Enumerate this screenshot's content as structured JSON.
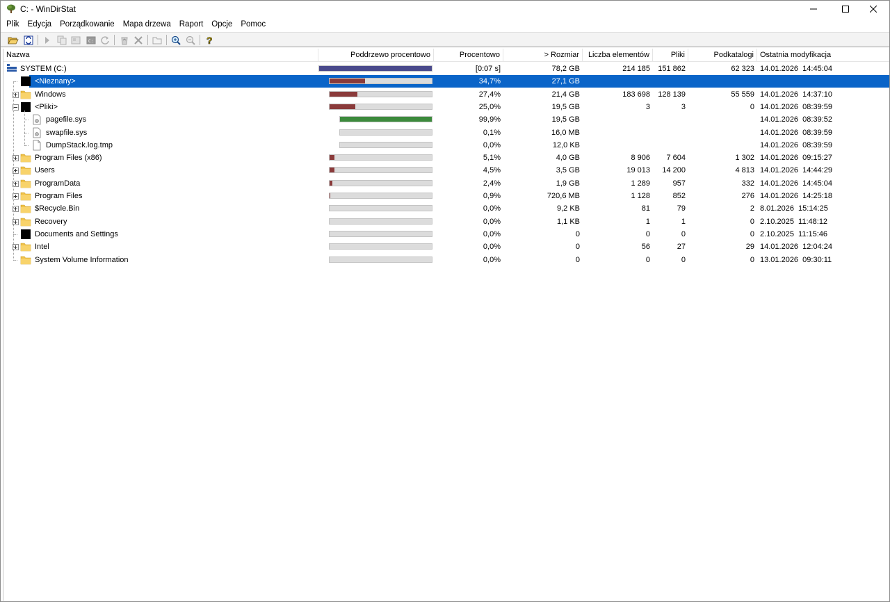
{
  "window": {
    "title": "C: - WinDirStat"
  },
  "menu": [
    "Plik",
    "Edycja",
    "Porządkowanie",
    "Mapa drzewa",
    "Raport",
    "Opcje",
    "Pomoc"
  ],
  "columns": {
    "name": "Nazwa",
    "subtree": "Poddrzewo procentowo",
    "percent": "Procentowo",
    "size": "> Rozmiar",
    "items": "Liczba elementów",
    "files": "Pliki",
    "subdirs": "Podkatalogi",
    "modified": "Ostatnia modyfikacja"
  },
  "colors": {
    "root_bar": "#4a4a8c",
    "dir_bar": "#8a3a3a",
    "file_bar": "#3c8a3c",
    "selection": "#0a64c8"
  },
  "rows": [
    {
      "name": "SYSTEM (C:)",
      "icon": "drive-icon",
      "percent": "[0:07 s]",
      "size": "78,2 GB",
      "items": "214 185",
      "files": "151 862",
      "subdirs": "62 323",
      "modified": "14.01.2026  14:45:04",
      "bar": 1.0
    },
    {
      "name": "<Nieznany>",
      "icon": "black-square-icon",
      "percent": "34,7%",
      "size": "27,1 GB",
      "items": "",
      "files": "",
      "subdirs": "",
      "modified": "",
      "bar": 0.347
    },
    {
      "name": "Windows",
      "icon": "folder-icon",
      "percent": "27,4%",
      "size": "21,4 GB",
      "items": "183 698",
      "files": "128 139",
      "subdirs": "55 559",
      "modified": "14.01.2026  14:37:10",
      "bar": 0.274
    },
    {
      "name": "<Pliki>",
      "icon": "black-square-icon",
      "percent": "25,0%",
      "size": "19,5 GB",
      "items": "3",
      "files": "3",
      "subdirs": "0",
      "modified": "14.01.2026  08:39:59",
      "bar": 0.25
    },
    {
      "name": "pagefile.sys",
      "icon": "system-file-icon",
      "percent": "99,9%",
      "size": "19,5 GB",
      "items": "",
      "files": "",
      "subdirs": "",
      "modified": "14.01.2026  08:39:52",
      "bar": 0.999
    },
    {
      "name": "swapfile.sys",
      "icon": "system-file-icon",
      "percent": "0,1%",
      "size": "16,0 MB",
      "items": "",
      "files": "",
      "subdirs": "",
      "modified": "14.01.2026  08:39:59",
      "bar": 0.001
    },
    {
      "name": "DumpStack.log.tmp",
      "icon": "file-icon",
      "percent": "0,0%",
      "size": "12,0 KB",
      "items": "",
      "files": "",
      "subdirs": "",
      "modified": "14.01.2026  08:39:59",
      "bar": 0.0
    },
    {
      "name": "Program Files (x86)",
      "icon": "folder-icon",
      "percent": "5,1%",
      "size": "4,0 GB",
      "items": "8 906",
      "files": "7 604",
      "subdirs": "1 302",
      "modified": "14.01.2026  09:15:27",
      "bar": 0.051
    },
    {
      "name": "Users",
      "icon": "folder-icon",
      "percent": "4,5%",
      "size": "3,5 GB",
      "items": "19 013",
      "files": "14 200",
      "subdirs": "4 813",
      "modified": "14.01.2026  14:44:29",
      "bar": 0.045
    },
    {
      "name": "ProgramData",
      "icon": "folder-icon",
      "percent": "2,4%",
      "size": "1,9 GB",
      "items": "1 289",
      "files": "957",
      "subdirs": "332",
      "modified": "14.01.2026  14:45:04",
      "bar": 0.024
    },
    {
      "name": "Program Files",
      "icon": "folder-icon",
      "percent": "0,9%",
      "size": "720,6 MB",
      "items": "1 128",
      "files": "852",
      "subdirs": "276",
      "modified": "14.01.2026  14:25:18",
      "bar": 0.009
    },
    {
      "name": "$Recycle.Bin",
      "icon": "folder-icon",
      "percent": "0,0%",
      "size": "9,2 KB",
      "items": "81",
      "files": "79",
      "subdirs": "2",
      "modified": "8.01.2026  15:14:25",
      "bar": 0.0
    },
    {
      "name": "Recovery",
      "icon": "folder-icon",
      "percent": "0,0%",
      "size": "1,1 KB",
      "items": "1",
      "files": "1",
      "subdirs": "0",
      "modified": "2.10.2025  11:48:12",
      "bar": 0.0
    },
    {
      "name": "Documents and Settings",
      "icon": "black-square-icon",
      "percent": "0,0%",
      "size": "0",
      "items": "0",
      "files": "0",
      "subdirs": "0",
      "modified": "2.10.2025  11:15:46",
      "bar": 0.0
    },
    {
      "name": "Intel",
      "icon": "folder-icon",
      "percent": "0,0%",
      "size": "0",
      "items": "56",
      "files": "27",
      "subdirs": "29",
      "modified": "14.01.2026  12:04:24",
      "bar": 0.0
    },
    {
      "name": "System Volume Information",
      "icon": "folder-icon",
      "percent": "0,0%",
      "size": "0",
      "items": "0",
      "files": "0",
      "subdirs": "0",
      "modified": "13.01.2026  09:30:11",
      "bar": 0.0
    }
  ]
}
